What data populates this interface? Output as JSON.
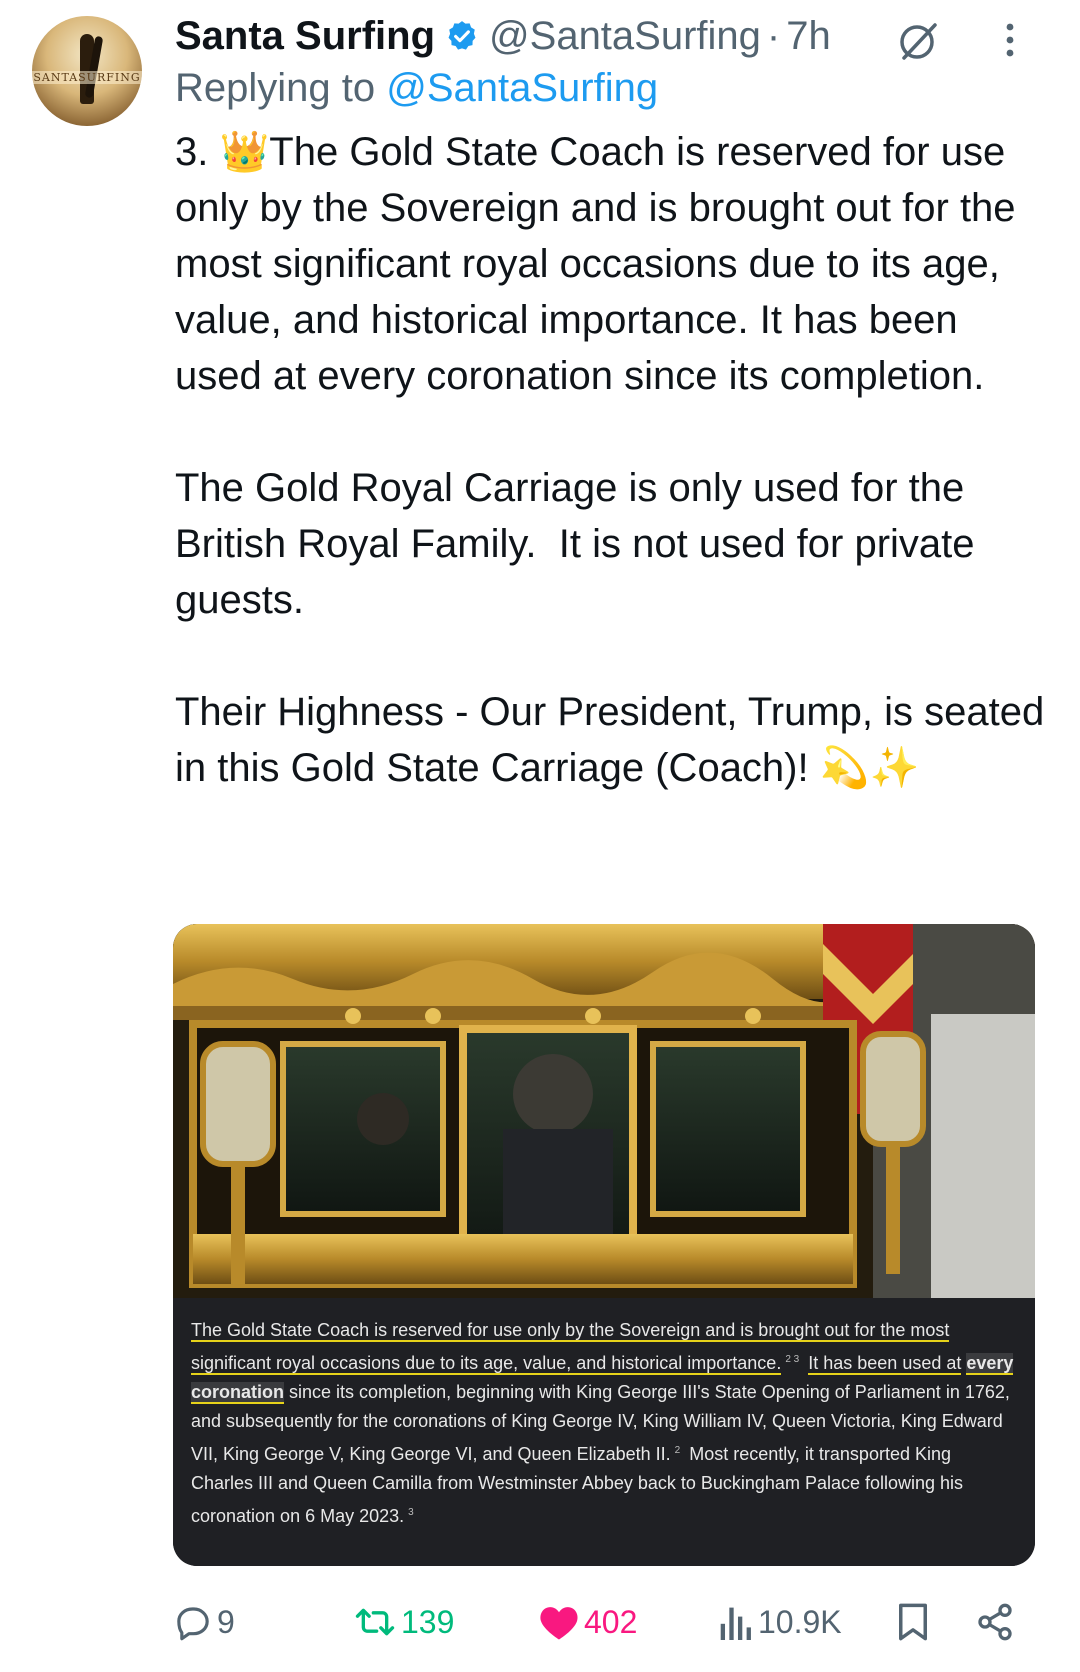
{
  "author": {
    "name": "Santa Surfing",
    "handle": "@SantaSurfing",
    "separator": "·",
    "time": "7h",
    "avatar_text": "SANTASURFING",
    "verified_color": "#1d9bf0"
  },
  "reply": {
    "prefix": "Replying to ",
    "mention": "@SantaSurfing"
  },
  "tweet": {
    "paragraphs": [
      "3. 👑The Gold State Coach is reserved for use only by the Sovereign and is brought out for the most significant royal occasions due to its age, value, and historical importance. It has been used at every coronation since its completion.",
      "The Gold Royal Carriage is only used for the British Royal Family.  It is not used for private guests.",
      "Their Highness - Our President, Trump, is seated in this Gold State Carriage (Coach)! 💫✨"
    ]
  },
  "media": {
    "caption": {
      "part1": "The Gold State Coach is reserved for use only by the Sovereign and is brought out for the most significant royal occasions due to its age, value, and historical importance.",
      "sup1": "2  3",
      "part2": "It has been used at",
      "strong": "every coronation",
      "part3": "since its completion, beginning with King George III's State Opening of Parliament in 1762, and subsequently for the coronations of King George IV, King William IV, Queen Victoria, King Edward VII, King George V, King George VI, and Queen Elizabeth II.",
      "sup2": "2",
      "part4": "Most recently, it transported King Charles III and Queen Camilla from Westminster Abbey back to Buckingham Palace following his coronation on 6 May 2023.",
      "sup3": "3"
    }
  },
  "actions": {
    "replies": "9",
    "retweets": "139",
    "likes": "402",
    "views": "10.9K",
    "icons": [
      "reply-icon",
      "retweet-icon",
      "heart-icon",
      "views-icon",
      "bookmark-icon",
      "share-icon"
    ],
    "colors": {
      "retweet": "#00ba7c",
      "like": "#f91880",
      "muted": "#536471"
    }
  }
}
